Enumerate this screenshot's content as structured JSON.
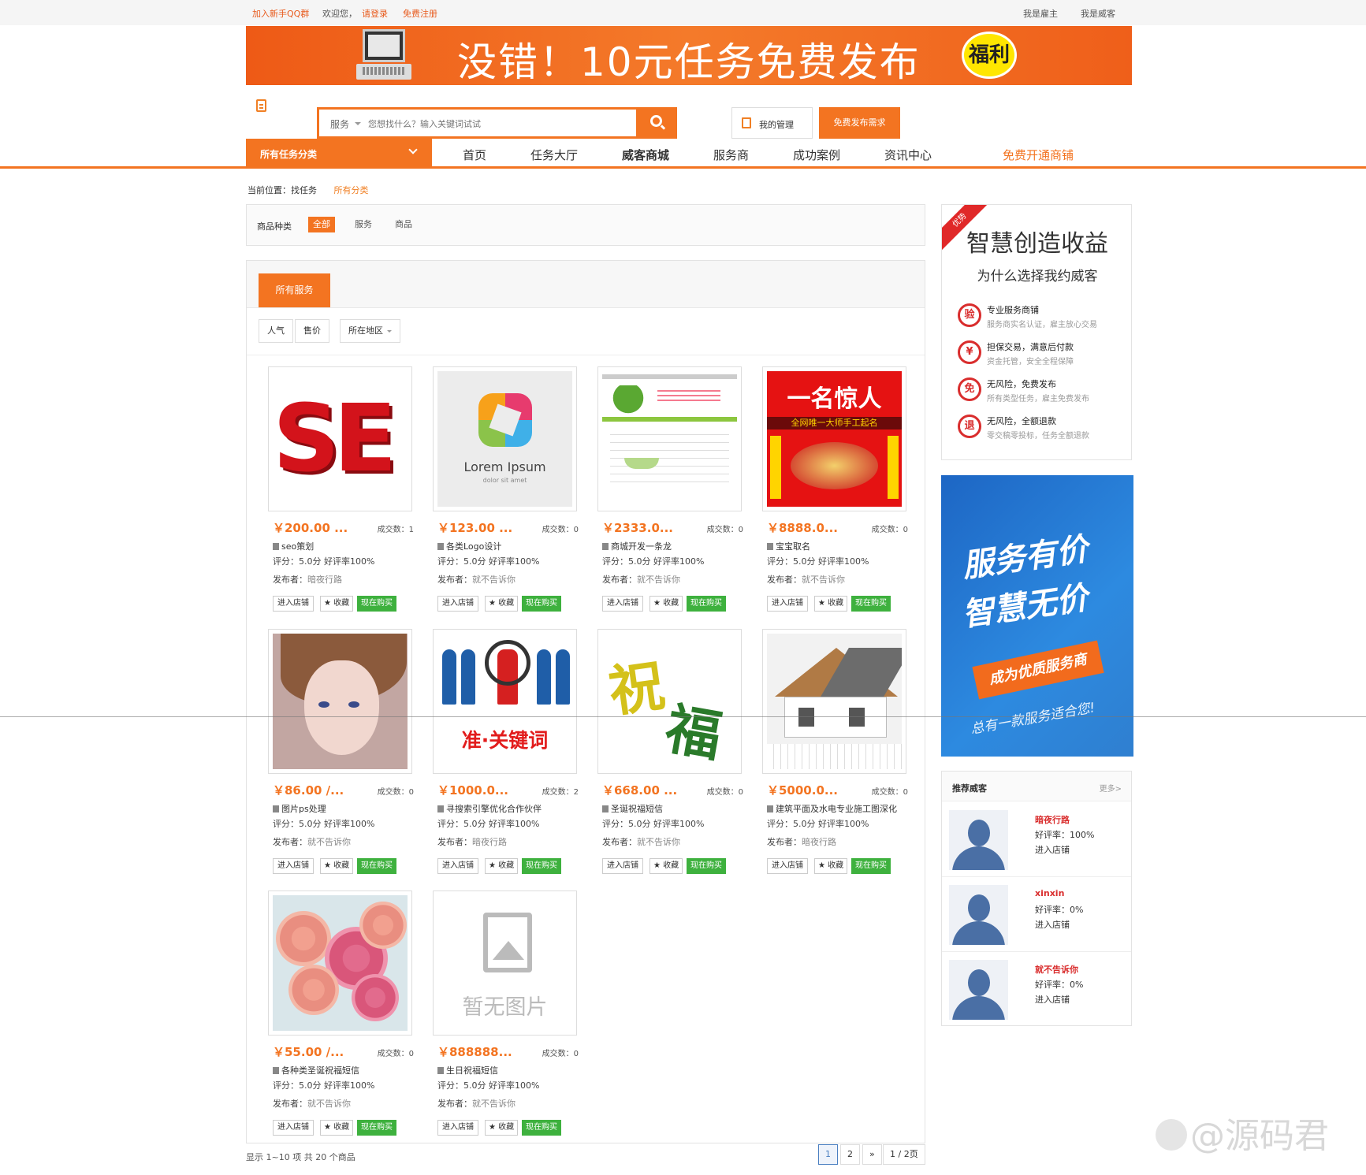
{
  "topbar": {
    "join_qq": "加入新手QQ群",
    "welcome": "欢迎您，",
    "login": "请登录",
    "register": "免费注册",
    "employer_menu": "我是雇主",
    "witkey_menu": "我是威客"
  },
  "banner": {
    "text": "没错！10元任务免费发布",
    "badge": "福利"
  },
  "search": {
    "category": "服务",
    "placeholder": "您想找什么？输入关键词试试",
    "my_manage": "我的管理",
    "publish_button": "免费发布需求"
  },
  "nav": {
    "all_categories": "所有任务分类",
    "items": [
      "首页",
      "任务大厅",
      "威客商城",
      "服务商",
      "成功案例",
      "资讯中心"
    ],
    "open_shop": "免费开通商铺"
  },
  "breadcrumb": {
    "label": "当前位置：找任务",
    "current": "所有分类"
  },
  "filter": {
    "label": "商品种类",
    "options": [
      "全部",
      "服务",
      "商品"
    ]
  },
  "main": {
    "tab": "所有服务",
    "sort": [
      "人气",
      "售价",
      "所在地区"
    ]
  },
  "products": [
    {
      "price": "￥200.00 ...",
      "deals": "成交数：1",
      "title": "seo策划",
      "rating": "评分：5.0分 好评率100%",
      "publisher_label": "发布者：",
      "publisher": "暗夜行路",
      "thumb": "seo"
    },
    {
      "price": "￥123.00 ...",
      "deals": "成交数：0",
      "title": "各类Logo设计",
      "rating": "评分：5.0分 好评率100%",
      "publisher_label": "发布者：",
      "publisher": "就不告诉你",
      "thumb": "logo"
    },
    {
      "price": "￥2333.0...",
      "deals": "成交数：0",
      "title": "商城开发一条龙",
      "rating": "评分：5.0分 好评率100%",
      "publisher_label": "发布者：",
      "publisher": "就不告诉你",
      "thumb": "web"
    },
    {
      "price": "￥8888.0...",
      "deals": "成交数：0",
      "title": "宝宝取名",
      "rating": "评分：5.0分 好评率100%",
      "publisher_label": "发布者：",
      "publisher": "就不告诉你",
      "thumb": "mname"
    },
    {
      "price": "￥86.00 /...",
      "deals": "成交数：0",
      "title": "图片ps处理",
      "rating": "评分：5.0分 好评率100%",
      "publisher_label": "发布者：",
      "publisher": "就不告诉你",
      "thumb": "girl"
    },
    {
      "price": "￥1000.0...",
      "deals": "成交数：2",
      "title": "寻搜索引擎优化合作伙伴",
      "rating": "评分：5.0分 好评率100%",
      "publisher_label": "发布者：",
      "publisher": "暗夜行路",
      "thumb": "people"
    },
    {
      "price": "￥668.00 ...",
      "deals": "成交数：0",
      "title": "圣诞祝福短信",
      "rating": "评分：5.0分 好评率100%",
      "publisher_label": "发布者：",
      "publisher": "就不告诉你",
      "thumb": "zhu"
    },
    {
      "price": "￥5000.0...",
      "deals": "成交数：0",
      "title": "建筑平面及水电专业施工图深化",
      "rating": "评分：5.0分 好评率100%",
      "publisher_label": "发布者：",
      "publisher": "暗夜行路",
      "thumb": "house"
    },
    {
      "price": "￥55.00 /...",
      "deals": "成交数：0",
      "title": "各种类圣诞祝福短信",
      "rating": "评分：5.0分 好评率100%",
      "publisher_label": "发布者：",
      "publisher": "就不告诉你",
      "thumb": "flower"
    },
    {
      "price": "￥888888...",
      "deals": "成交数：0",
      "title": "生日祝福短信",
      "rating": "评分：5.0分 好评率100%",
      "publisher_label": "发布者：",
      "publisher": "就不告诉你",
      "thumb": "noimg"
    }
  ],
  "card_buttons": {
    "shop": "进入店铺",
    "fav": "★ 收藏",
    "buy": "现在购买"
  },
  "thumbs": {
    "seo_text": "SE",
    "logo_main": "Lorem Ipsum",
    "logo_sub": "dolor sit amet",
    "mname_title": "一名惊人",
    "mname_bar": "全网唯一大师手工起名",
    "people_kw": "准·关键词",
    "zhu_a": "祝",
    "zhu_b": "福",
    "noimg_text": "暂无图片"
  },
  "footer": {
    "showing": "显示 1~10 项 共 20 个商品",
    "pages": [
      "1",
      "2",
      "»",
      "1 / 2页"
    ]
  },
  "advantages": {
    "corner": "优势",
    "title": "智慧创造收益",
    "subtitle": "为什么选择我约威客",
    "items": [
      {
        "icon": "验",
        "title": "专业服务商铺",
        "desc": "服务商实名认证，雇主放心交易"
      },
      {
        "icon": "¥",
        "title": "担保交易，满意后付款",
        "desc": "资金托管，安全全程保障"
      },
      {
        "icon": "免",
        "title": "无风险，免费发布",
        "desc": "所有类型任务，雇主免费发布"
      },
      {
        "icon": "退",
        "title": "无风险，全额退款",
        "desc": "零交稿零投标，任务全额退款"
      }
    ]
  },
  "blue_ad": {
    "line1": "服务有价",
    "line2": "智慧无价",
    "ribbon": "成为优质服务商",
    "sign": "总有一款服务适合您!"
  },
  "recommend": {
    "title": "推荐威客",
    "more": "更多>",
    "users": [
      {
        "name": "暗夜行路",
        "rate": "好评率：100%",
        "shop": "进入店铺"
      },
      {
        "name": "xinxin",
        "rate": "好评率：0%",
        "shop": "进入店铺"
      },
      {
        "name": "就不告诉你",
        "rate": "好评率：0%",
        "shop": "进入店铺"
      }
    ]
  },
  "watermark": "@源码君",
  "colors": {
    "accent": "#f37421",
    "buy": "#3eb13e",
    "name_red": "#d92d2d"
  }
}
